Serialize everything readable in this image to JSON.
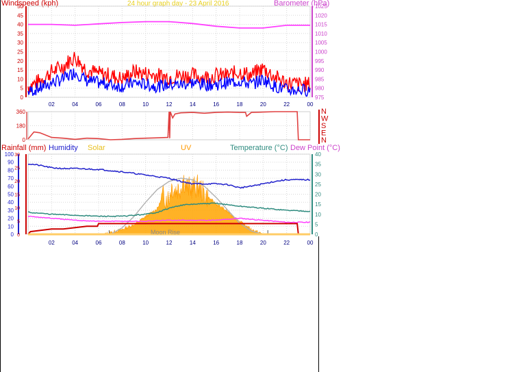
{
  "header": {
    "title": "24 hour graph day - 23 April 2016",
    "left_axis": "Windspeed (kph)",
    "right_axis": "Barometer (hPa)"
  },
  "bottom_labels": {
    "rainfall": "Rainfall (mm)",
    "humidity": "Humidity",
    "solar": "Solar",
    "uv": "UV",
    "temperature": "Temperature (°C)",
    "dewpoint": "Dew Point (°C)",
    "moon": "Moon Rise"
  },
  "colors": {
    "gust": "#ff0000",
    "wind": "#0000ff",
    "baro": "#ff40ff",
    "direction": "#e04040",
    "rain": "#cc0000",
    "humidity": "#2020cc",
    "solar": "#ffa500",
    "temperature": "#2e8b7f",
    "dewpoint": "#ff40ff",
    "sun_curve": "#b0b0b0",
    "grid": "#d8d8d8",
    "axis_left": "#cc0000",
    "axis_right": "#cc44cc",
    "title": "#e8d020"
  },
  "chart_data": [
    {
      "type": "line",
      "title": "24 hour graph day - 23 April 2016",
      "ylabel": "Windspeed (kph)",
      "y2label": "Barometer (hPa)",
      "x_ticks": [
        "02",
        "04",
        "06",
        "08",
        "10",
        "12",
        "14",
        "16",
        "18",
        "20",
        "22",
        "00"
      ],
      "ylim": [
        0,
        50
      ],
      "y_ticks": [
        0,
        5,
        10,
        15,
        20,
        25,
        30,
        35,
        40,
        45,
        50
      ],
      "y2lim": [
        975,
        1025
      ],
      "y2_ticks": [
        975,
        980,
        985,
        990,
        995,
        1000,
        1005,
        1010,
        1015,
        1020,
        1025
      ],
      "grid": true,
      "series": [
        {
          "name": "Gust",
          "x": [
            0,
            1,
            2,
            3,
            3.5,
            4,
            5,
            6,
            7,
            8,
            9,
            10,
            11,
            12,
            13,
            14,
            15,
            16,
            17,
            18,
            19,
            20,
            21,
            22,
            23,
            24
          ],
          "values": [
            6,
            9,
            14,
            17,
            20,
            22,
            15,
            13,
            12,
            10,
            14,
            13,
            12,
            11,
            12,
            12,
            11,
            12,
            12,
            14,
            12,
            16,
            11,
            8,
            7,
            7
          ]
        },
        {
          "name": "Average",
          "x": [
            0,
            1,
            2,
            3,
            3.5,
            4,
            5,
            6,
            7,
            8,
            9,
            10,
            11,
            12,
            13,
            14,
            15,
            16,
            17,
            18,
            19,
            20,
            21,
            22,
            23,
            24
          ],
          "values": [
            3,
            5,
            8,
            10,
            12,
            14,
            9,
            8,
            7,
            6,
            8,
            7,
            6,
            7,
            7,
            8,
            7,
            7,
            8,
            9,
            7,
            10,
            6,
            4,
            4,
            4
          ]
        },
        {
          "name": "Barometer",
          "x": [
            0,
            2,
            4,
            6,
            8,
            10,
            12,
            14,
            16,
            18,
            20,
            22,
            24
          ],
          "values": [
            1015,
            1015,
            1014.5,
            1015.3,
            1016,
            1016.5,
            1016.5,
            1015.5,
            1014,
            1013,
            1013,
            1014.5,
            1014.5
          ]
        }
      ]
    },
    {
      "type": "line",
      "y_ticks": [
        0,
        180,
        360
      ],
      "ylim": [
        0,
        360
      ],
      "direction_labels": [
        "N",
        "W",
        "S",
        "E",
        "N"
      ],
      "series": [
        {
          "name": "Direction",
          "x": [
            0,
            0.5,
            1,
            2,
            3,
            4,
            5,
            6,
            7,
            8,
            9,
            10,
            11,
            11.9,
            12,
            12.05,
            12.1,
            12.3,
            12.5,
            13,
            14,
            15,
            16,
            17,
            18,
            18.5,
            18.6,
            19,
            20,
            21,
            22,
            22.9,
            23,
            24
          ],
          "values": [
            10,
            100,
            90,
            30,
            20,
            5,
            20,
            15,
            0,
            5,
            15,
            20,
            25,
            30,
            360,
            20,
            360,
            280,
            330,
            345,
            350,
            340,
            350,
            355,
            350,
            350,
            300,
            350,
            355,
            360,
            360,
            360,
            0,
            0
          ]
        }
      ]
    },
    {
      "type": "line",
      "y_ticks_rain": [
        0,
        5,
        10,
        15,
        20,
        25,
        30
      ],
      "ylim_rain": [
        0,
        30
      ],
      "y_ticks_humidity": [
        0,
        10,
        20,
        30,
        40,
        50,
        60,
        70,
        80,
        90,
        100
      ],
      "ylim_humidity": [
        0,
        100
      ],
      "y2_ticks": [
        0,
        5,
        10,
        15,
        20,
        25,
        30,
        35,
        40
      ],
      "y2lim": [
        0,
        40
      ],
      "series": [
        {
          "name": "Humidity",
          "x": [
            0,
            1,
            2,
            3,
            4,
            6,
            8,
            10,
            12,
            13,
            14,
            15,
            16,
            17,
            18,
            19,
            20,
            21,
            22,
            23,
            24
          ],
          "values": [
            88,
            86,
            83,
            82,
            82,
            81,
            78,
            74,
            70,
            66,
            63,
            63,
            63,
            62,
            58,
            60,
            63,
            66,
            68,
            68,
            68
          ]
        },
        {
          "name": "Temperature",
          "x": [
            0,
            2,
            4,
            6,
            8,
            10,
            11,
            12,
            13,
            14,
            16,
            18,
            20,
            22,
            24
          ],
          "values": [
            11,
            10,
            9.5,
            9,
            9,
            10,
            11,
            13,
            14.5,
            15,
            15.5,
            14,
            13,
            12,
            11.5
          ]
        },
        {
          "name": "Dew Point",
          "x": [
            0,
            2,
            4,
            6,
            8,
            10,
            12,
            14,
            16,
            18,
            20,
            22,
            24
          ],
          "values": [
            9,
            8,
            7,
            6.5,
            6.5,
            6.5,
            7,
            7,
            7,
            8,
            7,
            6,
            6
          ]
        },
        {
          "name": "Rainfall",
          "x": [
            0,
            0.2,
            2,
            3,
            4,
            5,
            5.9,
            6,
            6.5,
            7,
            8,
            12,
            16,
            20,
            22,
            22.9,
            23,
            24
          ],
          "values": [
            0,
            1,
            2,
            2,
            2.5,
            3,
            3,
            4,
            4,
            4,
            4,
            4,
            4,
            4,
            4,
            4,
            0,
            0
          ]
        },
        {
          "name": "Solar",
          "x": [
            6.5,
            7,
            8,
            9,
            10,
            11,
            11.5,
            12,
            12.2,
            12.5,
            13,
            13.2,
            13.5,
            14,
            14.5,
            15,
            16,
            17,
            18,
            19,
            20
          ],
          "values": [
            0,
            2,
            6,
            12,
            22,
            32,
            48,
            45,
            60,
            55,
            58,
            70,
            58,
            58,
            60,
            50,
            38,
            28,
            16,
            6,
            0
          ]
        },
        {
          "name": "Sun Curve",
          "x": [
            7,
            8,
            9,
            10,
            11,
            12,
            13,
            14,
            15,
            16,
            17,
            18,
            19,
            20
          ],
          "values": [
            0,
            8,
            22,
            40,
            56,
            66,
            70,
            68,
            60,
            46,
            30,
            14,
            4,
            0
          ]
        }
      ]
    }
  ]
}
